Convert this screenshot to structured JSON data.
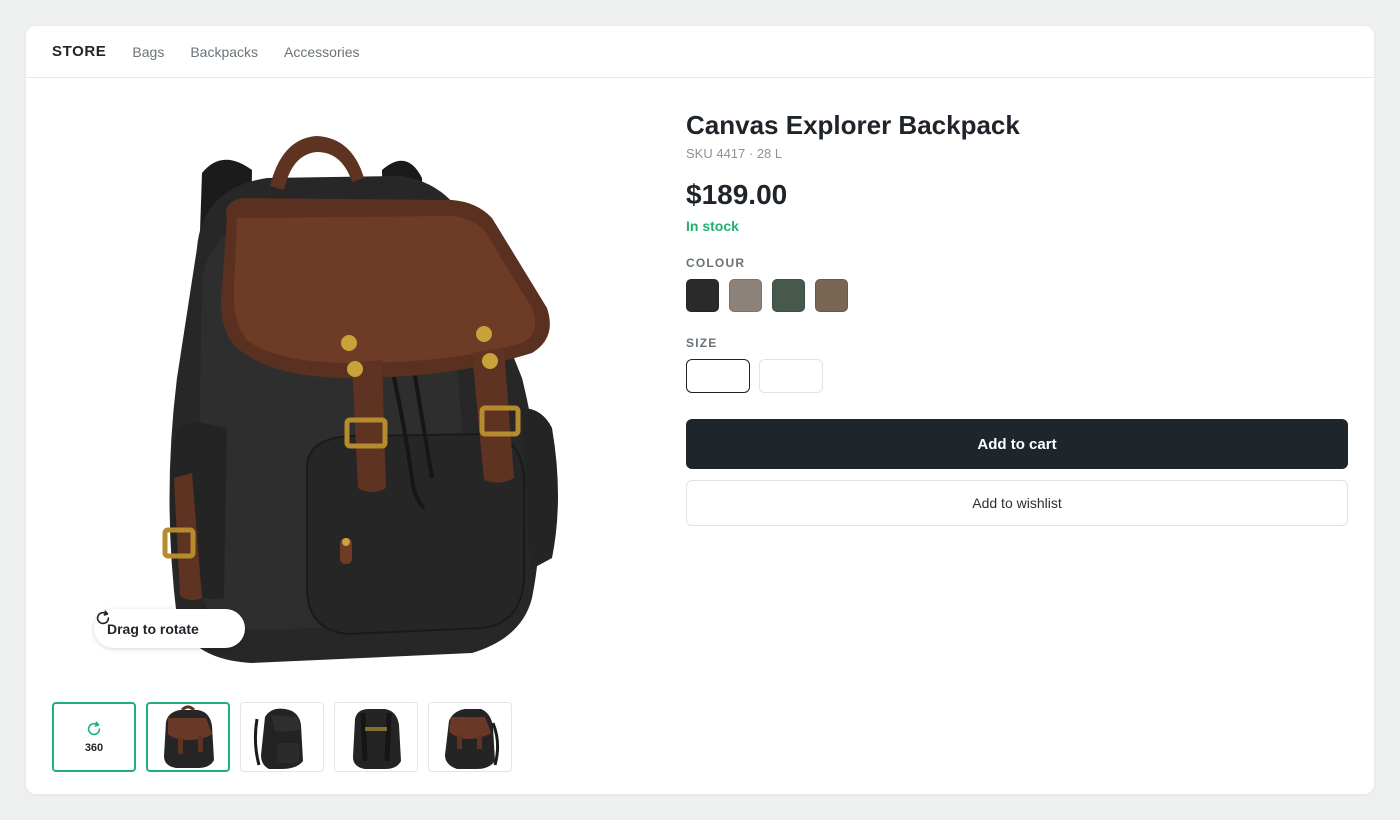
{
  "nav": {
    "brand": "STORE",
    "links": [
      "Bags",
      "Backpacks",
      "Accessories"
    ]
  },
  "gallery": {
    "main_image": "backpack-front-three-quarter",
    "rotate_hint": "Drag to rotate",
    "spin_label": "360",
    "thumbnails": [
      {
        "icon": "rotate-icon",
        "label": "360",
        "active": true
      },
      {
        "image": "backpack-front",
        "active": true
      },
      {
        "image": "backpack-side",
        "active": false
      },
      {
        "image": "backpack-back",
        "active": false
      },
      {
        "image": "backpack-angle",
        "active": false
      }
    ]
  },
  "product": {
    "title": "Canvas Explorer Backpack",
    "sku": "SKU 4417 · 28 L",
    "price": "$189.00",
    "stock": "In stock",
    "colour_label": "COLOUR",
    "colours": [
      "#2a2a2a",
      "#8c8279",
      "#46594c",
      "#7a6652"
    ],
    "size_label": "SIZE",
    "sizes": [
      "",
      ""
    ],
    "selected_size_index": 0
  },
  "actions": {
    "add_to_cart": "Add to cart",
    "add_to_wishlist": "Add to wishlist"
  },
  "colors": {
    "accent": "#20b07a",
    "stock": "#22b06f",
    "primary_button": "#1e262c"
  }
}
